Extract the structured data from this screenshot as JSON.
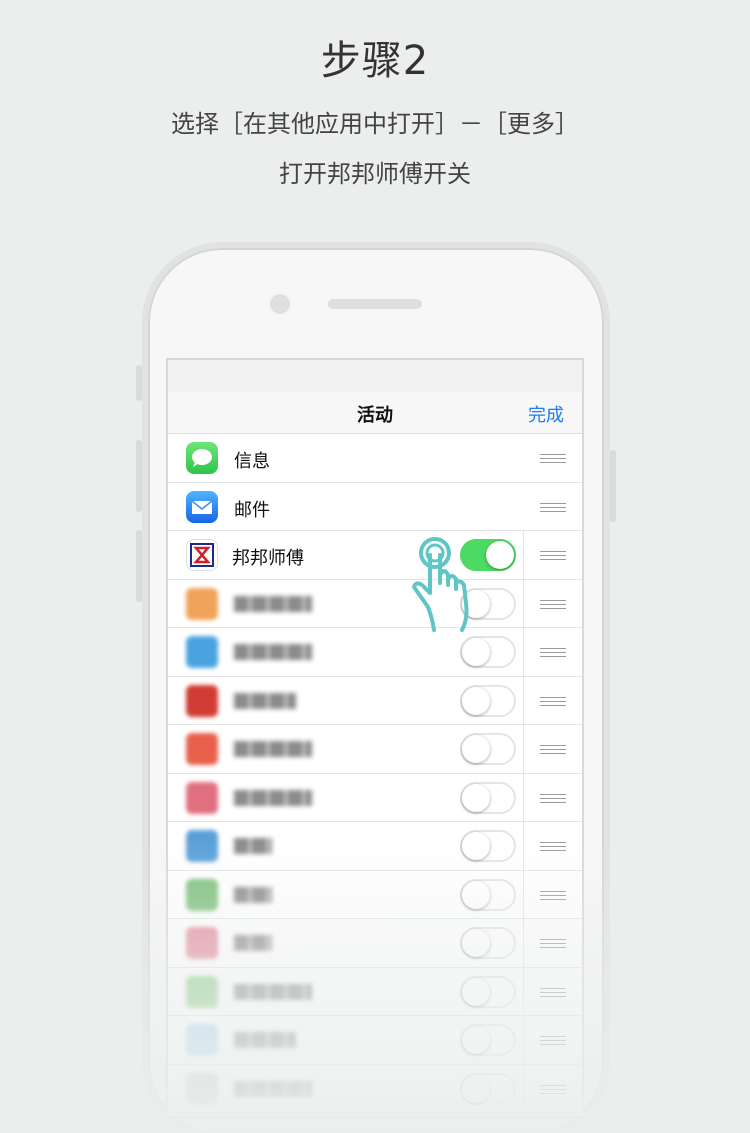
{
  "header": {
    "title": "步骤2",
    "instruction_line1": "选择［在其他应用中打开］－［更多］",
    "instruction_line2": "打开邦邦师傅开关"
  },
  "screen": {
    "nav_title": "活动",
    "done_label": "完成",
    "apps": [
      {
        "label": "信息",
        "icon": "messages-icon",
        "color": "#4cd964"
      },
      {
        "label": "邮件",
        "icon": "mail-icon",
        "color": "#1e90ff"
      },
      {
        "label": "邦邦师傅",
        "icon": "bangbang-logo-icon",
        "toggle": "on",
        "color": "#4cd964"
      }
    ],
    "blurred_rows": [
      {
        "icon_color": "#f0a35a",
        "toggle": "off"
      },
      {
        "icon_color": "#4aa3df",
        "toggle": "off"
      },
      {
        "icon_color": "#d23b34",
        "toggle": "off"
      },
      {
        "icon_color": "#e8604c",
        "toggle": "off"
      },
      {
        "icon_color": "#e07080",
        "toggle": "off"
      },
      {
        "icon_color": "#5aa0d8",
        "toggle": "off"
      },
      {
        "icon_color": "#7cc07a",
        "toggle": "off"
      },
      {
        "icon_color": "#e58a9a",
        "toggle": "off"
      },
      {
        "icon_color": "#8bcf8a",
        "toggle": "off"
      },
      {
        "icon_color": "#a8d4f0",
        "toggle": "off"
      },
      {
        "icon_color": "#c8c8c8",
        "toggle": "off"
      }
    ]
  },
  "colors": {
    "accent": "#1e7cf5",
    "toggle_on": "#4cd964",
    "pointer_hand": "#5ec6c4"
  }
}
